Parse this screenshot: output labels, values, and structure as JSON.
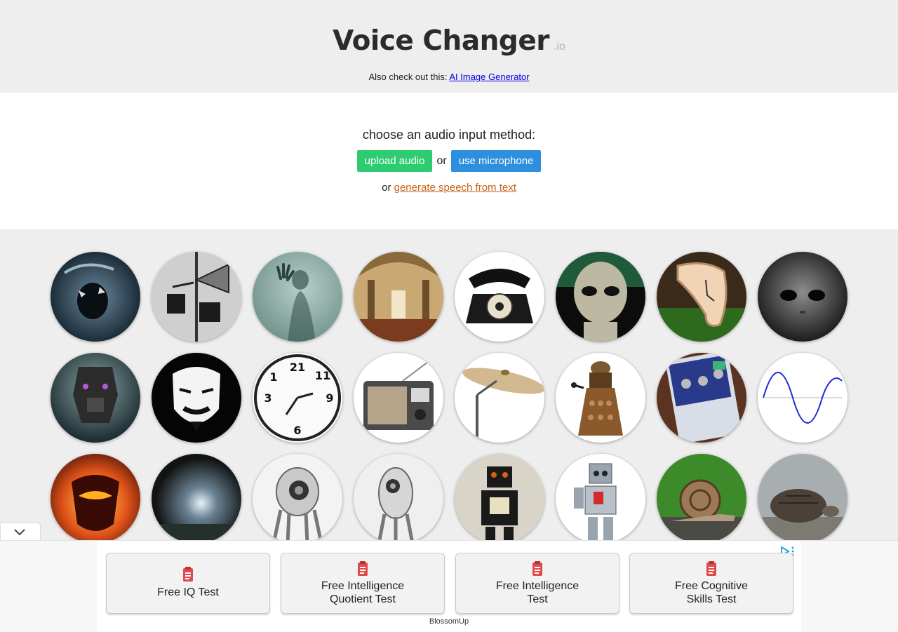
{
  "site": {
    "title": "Voice Changer",
    "suffix": ".io"
  },
  "checkout": {
    "prefix": "Also check out this:",
    "link_label": "AI Image Generator"
  },
  "input": {
    "prompt": "choose an audio input method:",
    "upload_label": "upload audio",
    "or_label": "or",
    "mic_label": "use microphone",
    "tts_prefix": "or",
    "tts_link": "generate speech from text"
  },
  "voices": [
    {
      "icon": "monster-roar-icon"
    },
    {
      "icon": "megaphone-icon"
    },
    {
      "icon": "ghost-icon"
    },
    {
      "icon": "cathedral-icon"
    },
    {
      "icon": "telephone-icon"
    },
    {
      "icon": "alien-icon"
    },
    {
      "icon": "melting-clock-icon"
    },
    {
      "icon": "grey-alien-icon"
    },
    {
      "icon": "robot-warrior-icon"
    },
    {
      "icon": "anonymous-mask-icon"
    },
    {
      "icon": "backwards-clock-icon"
    },
    {
      "icon": "radio-icon"
    },
    {
      "icon": "cymbal-icon"
    },
    {
      "icon": "dalek-icon"
    },
    {
      "icon": "effects-pedal-icon"
    },
    {
      "icon": "sine-wave-icon"
    },
    {
      "icon": "fire-demon-icon"
    },
    {
      "icon": "cave-icon"
    },
    {
      "icon": "eye-robot-icon"
    },
    {
      "icon": "eye-robot-2-icon"
    },
    {
      "icon": "tin-robot-icon"
    },
    {
      "icon": "toy-robot-icon"
    },
    {
      "icon": "snail-icon"
    },
    {
      "icon": "tortoise-icon"
    }
  ],
  "ad": {
    "buttons": [
      {
        "label": "Free IQ Test"
      },
      {
        "label": "Free Intelligence Quotient Test"
      },
      {
        "label": "Free Intelligence Test"
      },
      {
        "label": "Free Cognitive Skills Test"
      }
    ],
    "brand": "BlossomUp"
  }
}
